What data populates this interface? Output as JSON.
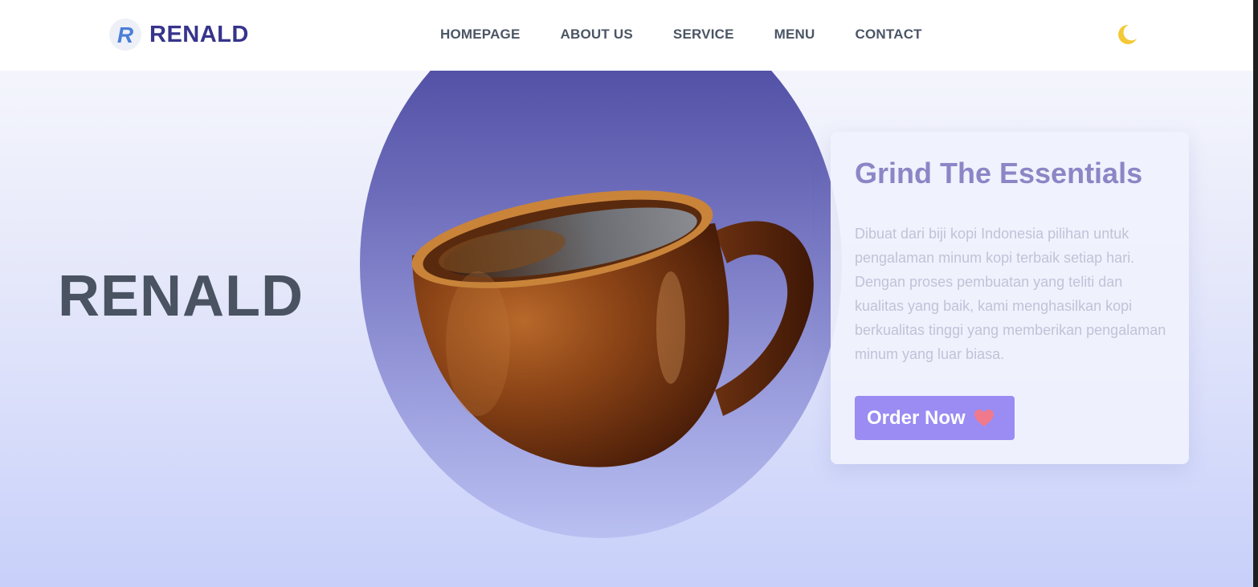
{
  "header": {
    "logo_letter": "R",
    "brand": "RENALD",
    "nav": [
      {
        "label": "HOMEPAGE"
      },
      {
        "label": "ABOUT US"
      },
      {
        "label": "SERVICE"
      },
      {
        "label": "MENU"
      },
      {
        "label": "CONTACT"
      }
    ],
    "theme_icon": "moon-icon"
  },
  "hero": {
    "brand": "RENALD",
    "card": {
      "title": "Grind The Essentials",
      "description": "Dibuat dari biji kopi Indonesia pilihan untuk pengalaman minum kopi terbaik setiap hari. Dengan proses pembuatan yang teliti dan kualitas yang baik, kami menghasilkan kopi berkualitas tinggi yang memberikan pengalaman minum yang luar biasa.",
      "button_label": "Order Now",
      "button_icon": "heart-icon"
    }
  },
  "colors": {
    "brand": "#37348c",
    "accent": "#9a8cf3",
    "circle": "#44419a",
    "moon": "#f4c935",
    "heart": "#f07a8c"
  }
}
